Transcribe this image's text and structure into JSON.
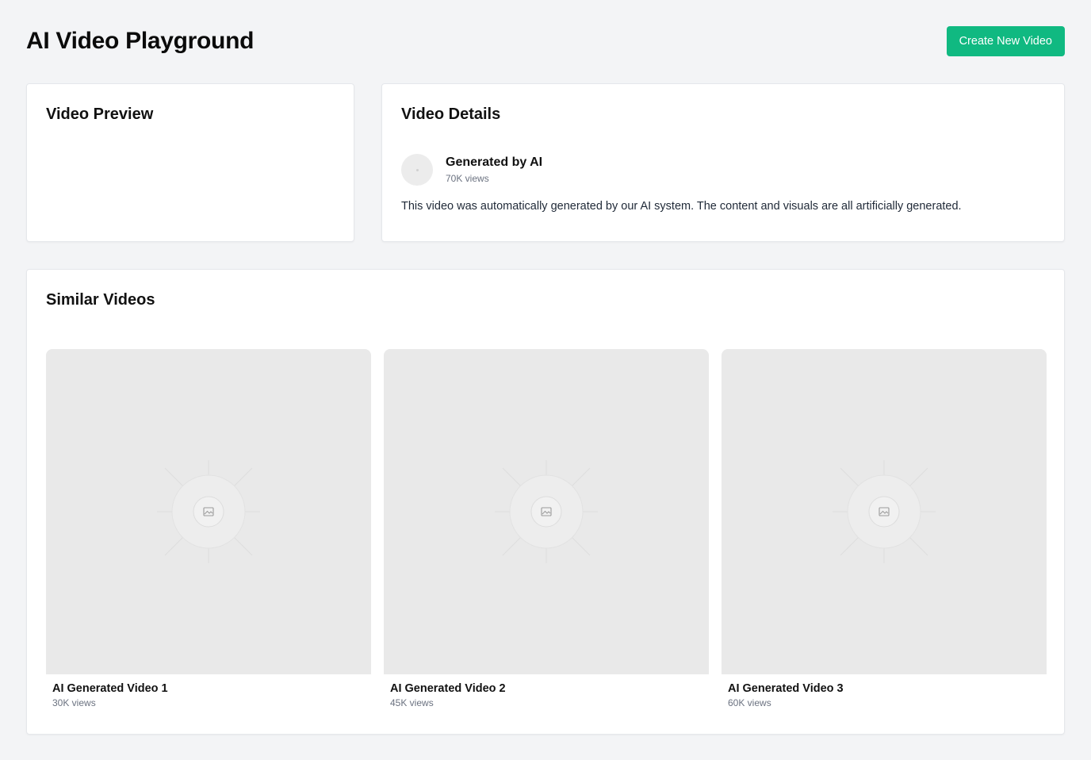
{
  "header": {
    "title": "AI Video Playground",
    "create_button": "Create New Video"
  },
  "preview": {
    "title": "Video Preview"
  },
  "details": {
    "title": "Video Details",
    "author": "Generated by AI",
    "views": "70K views",
    "description": "This video was automatically generated by our AI system. The content and visuals are all artificially generated."
  },
  "similar": {
    "title": "Similar Videos",
    "videos": [
      {
        "title": "AI Generated Video 1",
        "views": "30K views",
        "thumbnail_icon": "image-placeholder-icon"
      },
      {
        "title": "AI Generated Video 2",
        "views": "45K views",
        "thumbnail_icon": "image-placeholder-icon"
      },
      {
        "title": "AI Generated Video 3",
        "views": "60K views",
        "thumbnail_icon": "image-placeholder-icon"
      }
    ]
  },
  "colors": {
    "accent": "#10b981",
    "background": "#f3f4f6",
    "card": "#ffffff",
    "thumbnail": "#e9e9e9"
  }
}
